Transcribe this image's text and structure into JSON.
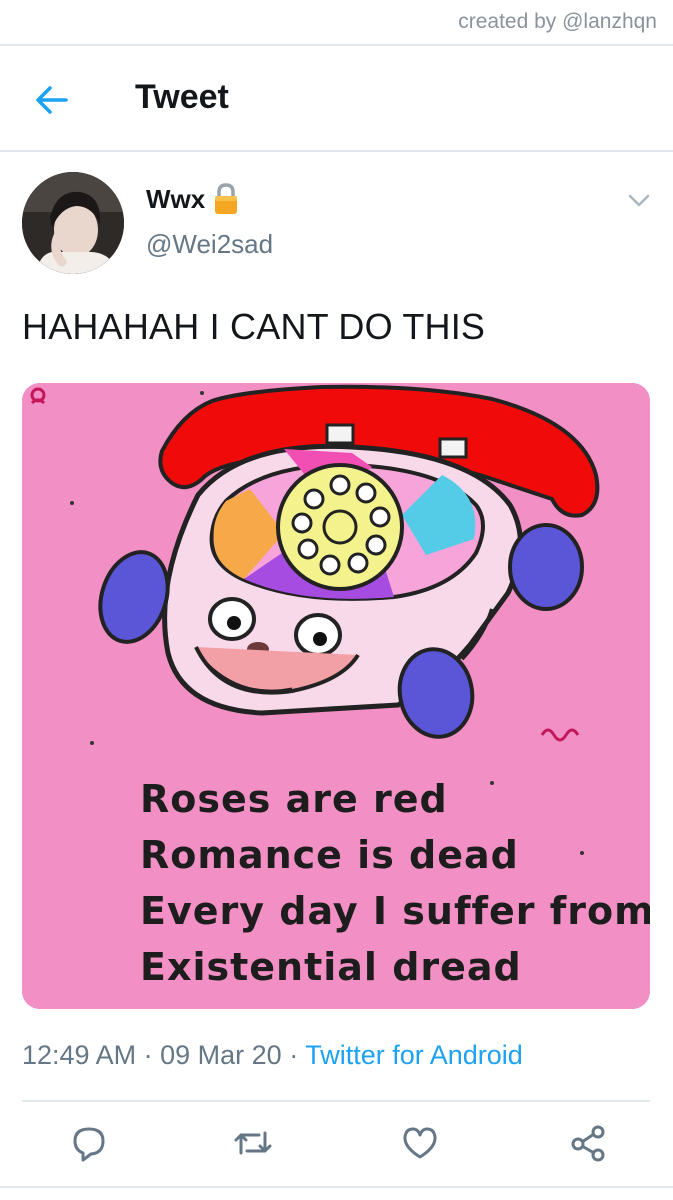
{
  "credit": {
    "text": "created by @lanzhqn"
  },
  "header": {
    "title": "Tweet",
    "back_icon": "arrow-left-icon"
  },
  "tweet": {
    "author_name": "Wwx",
    "author_handle": "@Wei2sad",
    "protected_icon": "lock-icon",
    "text": "HAHAHAH I CANT DO THIS",
    "media": {
      "poem_lines": [
        "Roses are red",
        "Romance is dead",
        "Every day I suffer from",
        "Existential dread"
      ]
    },
    "time": "12:49 AM",
    "date": "09 Mar 20",
    "source": "Twitter for Android",
    "separator": "·"
  },
  "actions": [
    "reply-icon",
    "retweet-icon",
    "like-icon",
    "share-icon"
  ],
  "colors": {
    "accent": "#1da1f2",
    "secondary_text": "#657786",
    "divider": "#e1e8ed",
    "media_bg": "#f28fc4"
  }
}
